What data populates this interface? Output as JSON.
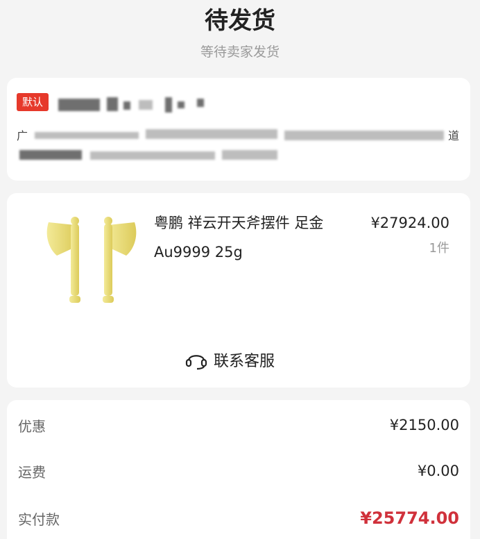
{
  "header": {
    "status_title": "待发货",
    "status_subtitle": "等待卖家发货"
  },
  "address": {
    "default_tag": "默认",
    "line_prefix": "广",
    "line_suffix": "道"
  },
  "product": {
    "name": "粤鹏 祥云开天斧摆件 足金 Au9999 25g",
    "price": "¥27924.00",
    "quantity": "1件",
    "image_icon": "gold-axe-pair-icon"
  },
  "service": {
    "label": "联系客服",
    "icon": "headset-icon"
  },
  "summary": {
    "discount_label": "优惠",
    "discount_value": "¥2150.00",
    "shipping_label": "运费",
    "shipping_value": "¥0.00",
    "paid_label": "实付款",
    "paid_value": "¥25774.00"
  },
  "colors": {
    "accent_red": "#e6392b",
    "price_red": "#d0313b",
    "gold": "#e7dc7a"
  }
}
